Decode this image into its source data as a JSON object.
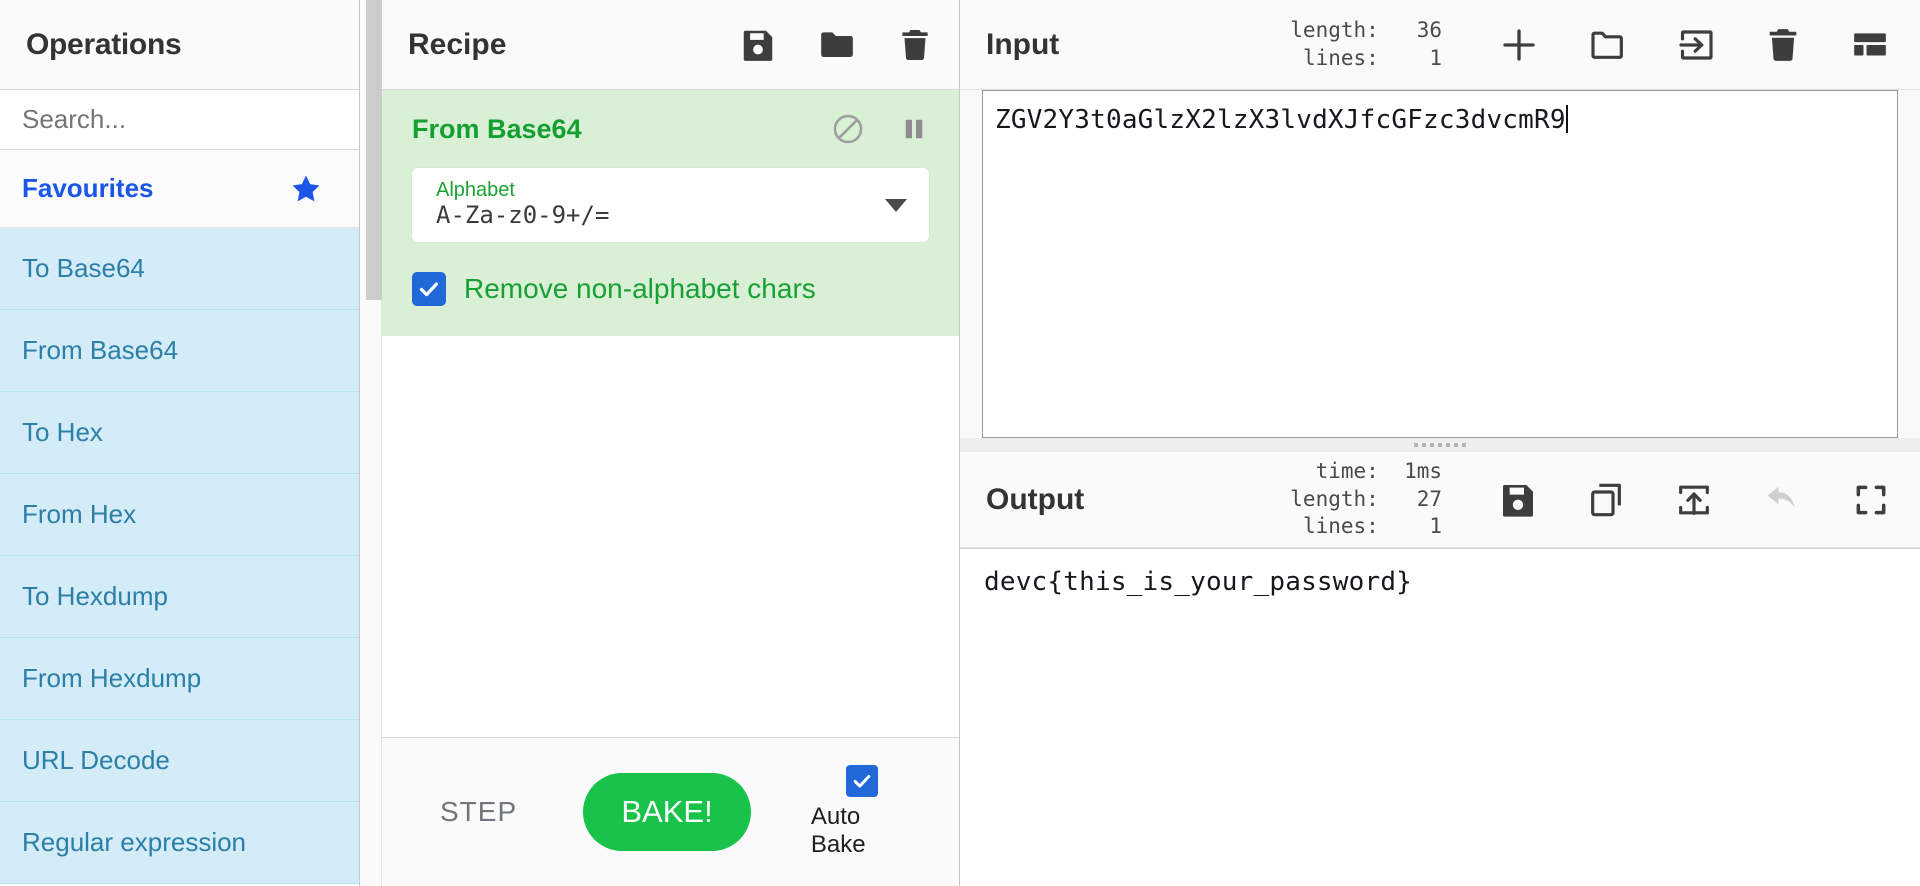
{
  "operations": {
    "title": "Operations",
    "search": {
      "placeholder": "Search...",
      "value": ""
    },
    "favourites_label": "Favourites",
    "star_icon": "star-icon",
    "items": [
      {
        "label": "To Base64"
      },
      {
        "label": "From Base64"
      },
      {
        "label": "To Hex"
      },
      {
        "label": "From Hex"
      },
      {
        "label": "To Hexdump"
      },
      {
        "label": "From Hexdump"
      },
      {
        "label": "URL Decode"
      },
      {
        "label": "Regular expression"
      }
    ]
  },
  "recipe": {
    "title": "Recipe",
    "header_icons": [
      {
        "name": "save-recipe-icon"
      },
      {
        "name": "load-recipe-icon"
      },
      {
        "name": "clear-recipe-icon"
      }
    ],
    "operation": {
      "title": "From Base64",
      "disable_icon": "disable-icon",
      "breakpoint_icon": "pause-icon",
      "alphabet_arg": {
        "label": "Alphabet",
        "value": "A-Za-z0-9+/=",
        "dropdown_icon": "chevron-down-icon"
      },
      "remove_non_alphabet": {
        "label": "Remove non-alphabet chars",
        "checked": true
      }
    },
    "controls": {
      "step_label": "STEP",
      "bake_label": "BAKE!",
      "auto_bake_label": "Auto Bake",
      "auto_bake_checked": true
    }
  },
  "input": {
    "title": "Input",
    "meta": [
      {
        "key": "length:",
        "value": "36"
      },
      {
        "key": "lines:",
        "value": "1"
      }
    ],
    "text": "ZGV2Y3t0aGlzX2lzX3lvdXJfcGFzc3dvcmR9",
    "icons": [
      {
        "name": "add-input-tab-icon"
      },
      {
        "name": "open-folder-icon"
      },
      {
        "name": "open-file-as-input-icon"
      },
      {
        "name": "clear-io-icon"
      },
      {
        "name": "panel-layout-icon"
      }
    ]
  },
  "output": {
    "title": "Output",
    "meta": [
      {
        "key": "time:",
        "value": "1ms"
      },
      {
        "key": "length:",
        "value": "27"
      },
      {
        "key": "lines:",
        "value": "1"
      }
    ],
    "text": "devc{this_is_your_password}",
    "icons": [
      {
        "name": "save-output-icon"
      },
      {
        "name": "copy-output-icon"
      },
      {
        "name": "replace-input-with-output-icon"
      },
      {
        "name": "undo-icon"
      },
      {
        "name": "maximise-output-icon"
      }
    ]
  },
  "colors": {
    "brand_green": "#19c249",
    "operation_green": "#14a031",
    "op_block_bg": "#d9f0d7",
    "favourite_blue": "#1a56e8",
    "op_item_bg": "#d3ecf7",
    "checkbox_blue": "#2069d7"
  }
}
